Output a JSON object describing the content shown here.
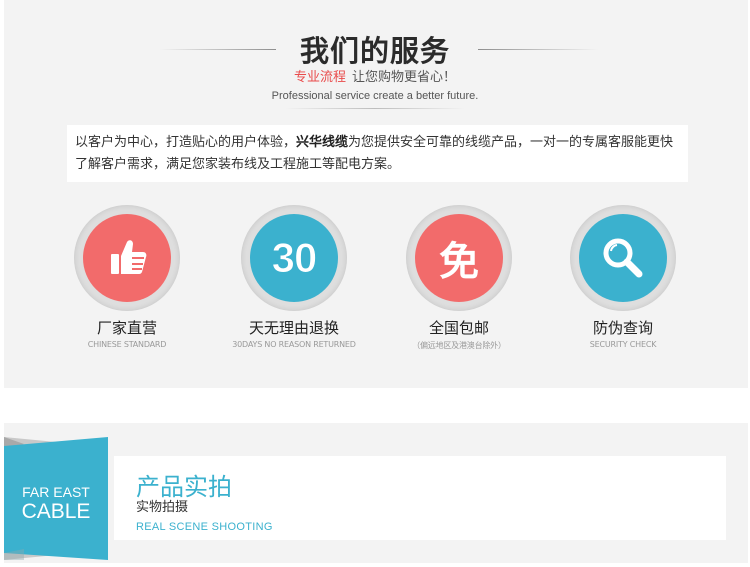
{
  "services_section": {
    "title": "我们的服务",
    "subtitle_accent": "专业流程",
    "subtitle_rest": "让您购物更省心！",
    "subtitle_en": "Professional service create a better future.",
    "intro_part1": "以客户为中心，打造贴心的用户体验，",
    "intro_brand": "兴华线缆",
    "intro_part2": "为您提供安全可靠的线缆产品，一对一的专属客服能更快了解客户需求，满足您家装布线及工程施工等配电方案。",
    "items": [
      {
        "name": "厂家直营",
        "sub": "CHINESE STANDARD",
        "icon": "thumbs-up-icon",
        "color": "#f26b6b"
      },
      {
        "name": "天无理由退换",
        "sub": "30DAYS NO REASON RETURNED",
        "icon_text": "30",
        "color": "#3bb1ce"
      },
      {
        "name": "全国包邮",
        "sub": "（偏远地区及港澳台除外）",
        "icon_text": "免",
        "color": "#f26b6b"
      },
      {
        "name": "防伪查询",
        "sub": "SECURITY CHECK",
        "icon": "magnifier-icon",
        "color": "#3bb1ce"
      }
    ]
  },
  "product_section": {
    "banner_line1": "FAR EAST",
    "banner_line2": "CABLE",
    "title": "产品实拍",
    "subtitle": "实物拍摄",
    "subtitle_en": "REAL SCENE SHOOTING",
    "accent_color": "#3bb1ce"
  }
}
